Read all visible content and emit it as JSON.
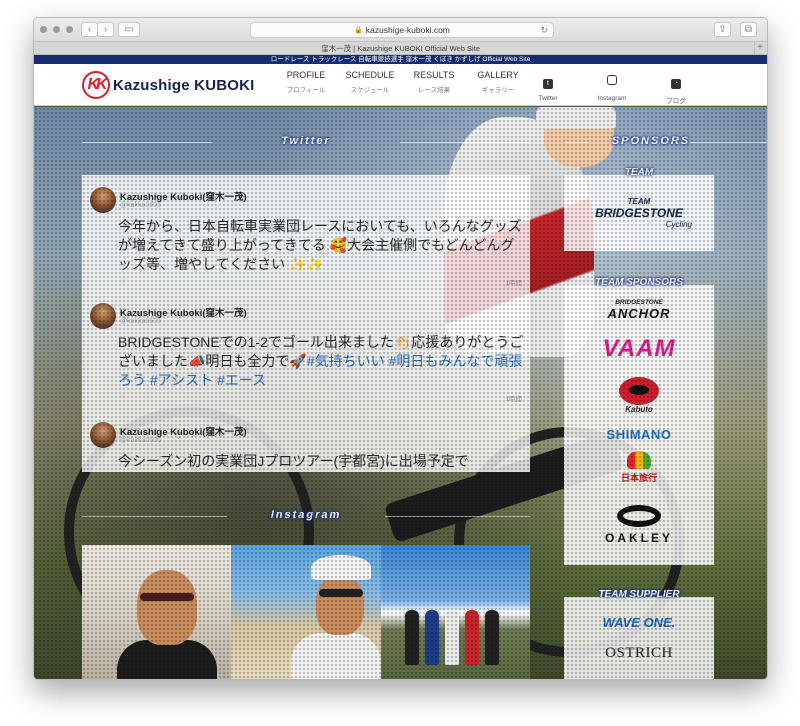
{
  "browser": {
    "url": "kazushige-kuboki.com",
    "tab_title": "窪木一茂 | Kazushige KUBOKI Official Web Site",
    "back_icon": "chevron-left-icon",
    "forward_icon": "chevron-right-icon",
    "lock_icon": "lock-icon",
    "plus_label": "+"
  },
  "site": {
    "ticker": "ロードレース トラックレース 自転車競技選手 窪木一茂 くぼき かずしげ Official Web Site",
    "logo_mark": "KK",
    "logo_text": "Kazushige KUBOKI",
    "accent_color": "#e31c2b",
    "brand_color": "#15244e"
  },
  "nav": [
    {
      "en": "PROFILE",
      "jp": "プロフィール"
    },
    {
      "en": "SCHEDULE",
      "jp": "スケジュール"
    },
    {
      "en": "RESULTS",
      "jp": "レース結果"
    },
    {
      "en": "GALLERY",
      "jp": "ギャラリー"
    }
  ],
  "social": [
    {
      "label": "Twitter",
      "icon": "twitter-icon"
    },
    {
      "label": "Instagram",
      "icon": "instagram-icon"
    },
    {
      "label": "ブログ",
      "icon": "rss-icon"
    }
  ],
  "twitter": {
    "title": "Twitter",
    "tweets": [
      {
        "name": "Kazushige Kuboki(窪木一茂)",
        "handle": "@kakka0606",
        "text": "今年から、日本自転車実業団レースにおいても、いろんなグッズが増えてきて盛り上がってきてる 🥰大会主催側でもどんどんグッズ等、増やしてください ✨✨",
        "time": "1時間"
      },
      {
        "name": "Kazushige Kuboki(窪木一茂)",
        "handle": "@kakka0606",
        "text_plain": "BRIDGESTONEでの1-2でゴール出来ました👏🏻応援ありがとうございました📣明日も全力で🚀",
        "text_tags": "#気持ちいい #明日もみんなで頑張ろう #アシスト #エース",
        "time": "1時間"
      },
      {
        "name": "Kazushige Kuboki(窪木一茂)",
        "handle": "@kakka0606",
        "text": "今シーズン初の実業団Jプロツアー(宇都宮)に出場予定で"
      }
    ]
  },
  "instagram": {
    "title": "Instagram"
  },
  "sponsors": {
    "title": "SPONSORS",
    "team_label": "TEAM",
    "team_logo_small": "TEAM",
    "team_logo_big": "BRIDGESTONE",
    "team_logo_cycling": "Cycling",
    "team_sponsors_label": "TEAM SPONSORS",
    "anchor_small": "BRIDGESTONE",
    "anchor_big": "ANCHOR",
    "vaam": "VAAM",
    "kabuto": "Kabuto",
    "shimano": "SHIMANO",
    "nihon_ryoko": "日本旅行",
    "oakley": "OAKLEY",
    "supplier_label": "TEAM SUPPLIER",
    "waveone": "WAVE ONE.",
    "ostrich": "OSTRICH"
  }
}
